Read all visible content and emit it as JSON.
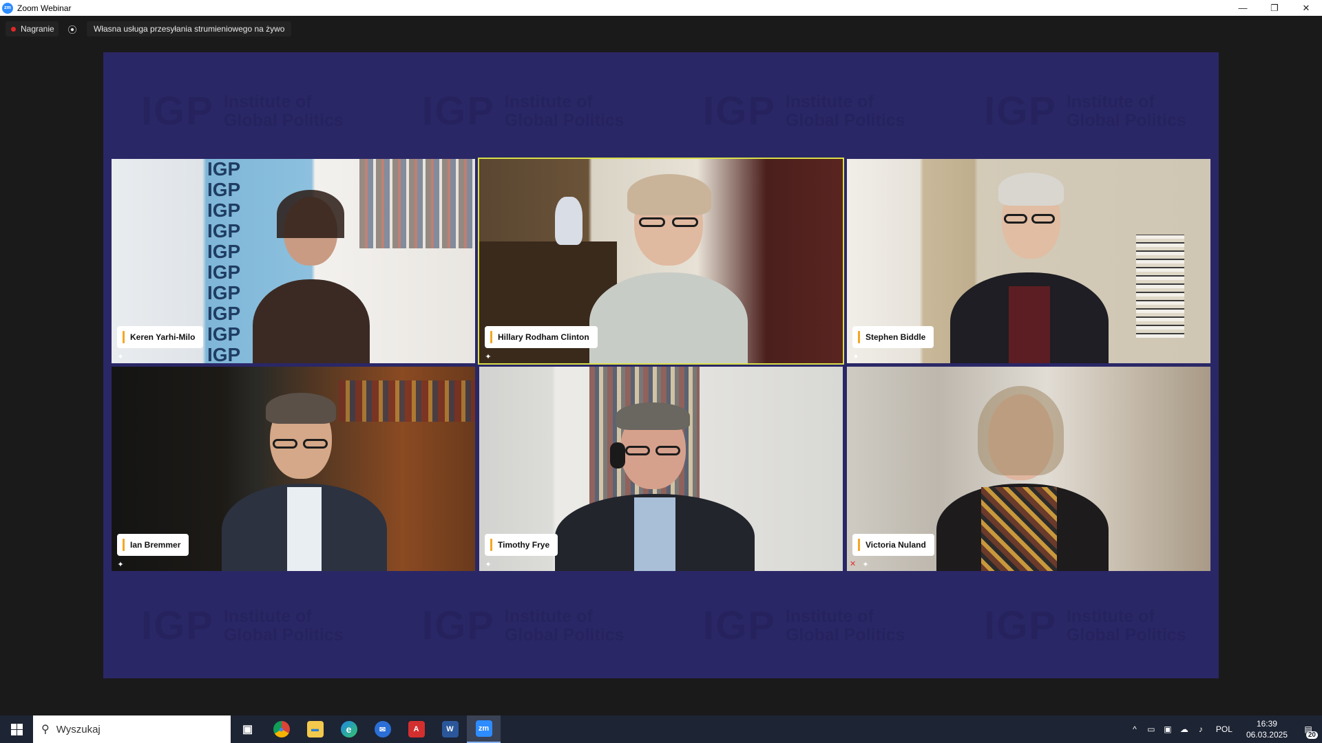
{
  "window": {
    "title": "Zoom Webinar",
    "logo_text": "zm",
    "minimize_icon": "—",
    "restore_icon": "❐",
    "close_icon": "✕"
  },
  "topbar": {
    "recording_label": "Nagranie",
    "stream_icon": "⦿",
    "stream_label": "Własna usługa przesyłania strumieniowego na żywo"
  },
  "watermark": {
    "big": "IGP",
    "line1": "Institute of",
    "line2": "Global Politics"
  },
  "participants": [
    {
      "name": "Keren Yarhi-Milo",
      "pinned": true,
      "muted": false,
      "active_speaker": false
    },
    {
      "name": "Hillary Rodham Clinton",
      "pinned": true,
      "muted": false,
      "active_speaker": true
    },
    {
      "name": "Stephen Biddle",
      "pinned": true,
      "muted": false,
      "active_speaker": false
    },
    {
      "name": "Ian Bremmer",
      "pinned": true,
      "muted": false,
      "active_speaker": false
    },
    {
      "name": "Timothy Frye",
      "pinned": true,
      "muted": false,
      "active_speaker": false
    },
    {
      "name": "Victoria Nuland",
      "pinned": true,
      "muted": true,
      "active_speaker": false
    }
  ],
  "icons": {
    "pin": "✦",
    "mic_off": "✕"
  },
  "taskbar": {
    "search_placeholder": "Wyszukaj",
    "search_icon": "⚲",
    "apps": [
      {
        "name": "task-view",
        "label": "▣",
        "color": "#1d2434"
      },
      {
        "name": "chrome",
        "label": "●",
        "color": "#db4437"
      },
      {
        "name": "file-explorer",
        "label": "▬",
        "color": "#f2c94c"
      },
      {
        "name": "edge",
        "label": "e",
        "color": "#1e88e5"
      },
      {
        "name": "thunderbird",
        "label": "✉",
        "color": "#2b6fd6"
      },
      {
        "name": "acrobat",
        "label": "A",
        "color": "#d32f2f"
      },
      {
        "name": "word",
        "label": "W",
        "color": "#2b579a"
      },
      {
        "name": "zoom",
        "label": "zm",
        "color": "#2d8cff"
      }
    ],
    "tray": {
      "chevron": "^",
      "lang": "POL",
      "time": "16:39",
      "date": "06.03.2025",
      "notifications": "20"
    }
  }
}
